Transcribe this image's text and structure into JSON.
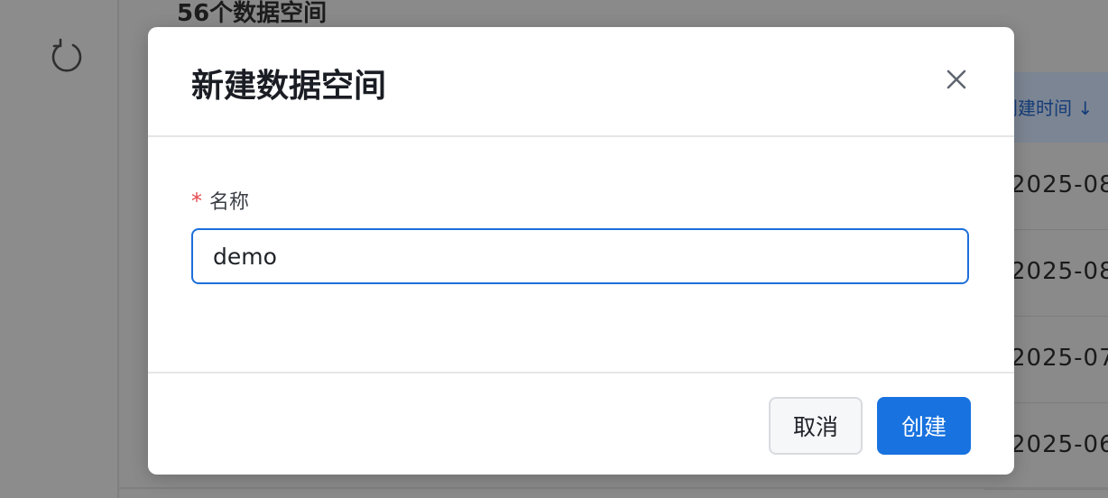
{
  "background": {
    "space_count_title": "56个数据空间",
    "icons": {
      "refresh": "refresh-icon"
    },
    "table": {
      "sort_header": "创建时间 ↓",
      "rows": [
        "2025-08-",
        "2025-08-",
        "2025-07-",
        "2025-06-"
      ]
    }
  },
  "modal": {
    "title": "新建数据空间",
    "close_icon": "close-icon",
    "form": {
      "required_mark": "*",
      "name_label": "名称",
      "name_value": "demo"
    },
    "footer": {
      "cancel_label": "取消",
      "create_label": "创建"
    }
  },
  "colors": {
    "primary": "#1872df",
    "required": "#e5484d",
    "overlay": "#8a8a8a"
  }
}
